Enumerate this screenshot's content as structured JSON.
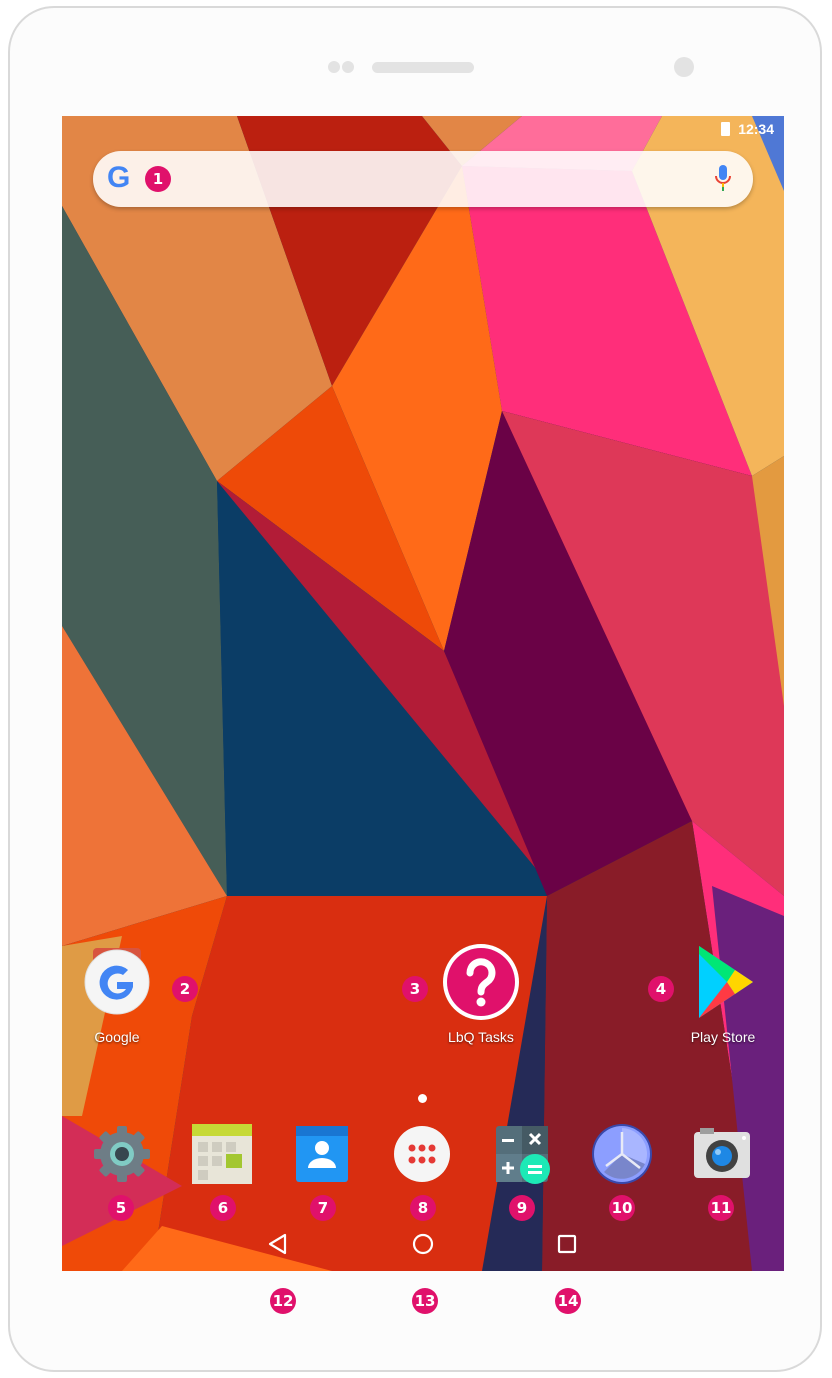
{
  "status_bar": {
    "time": "12:34"
  },
  "search_bar": {
    "logo": "G",
    "mic_icon": "mic-icon"
  },
  "home_apps": [
    {
      "label": "Google",
      "icon": "google-app-icon"
    },
    {
      "label": "LbQ Tasks",
      "icon": "lbq-tasks-icon"
    },
    {
      "label": "Play Store",
      "icon": "play-store-icon"
    }
  ],
  "dock": [
    {
      "icon": "settings-icon"
    },
    {
      "icon": "calendar-icon"
    },
    {
      "icon": "contacts-icon"
    },
    {
      "icon": "app-drawer-icon"
    },
    {
      "icon": "calculator-icon"
    },
    {
      "icon": "clock-icon"
    },
    {
      "icon": "camera-icon"
    }
  ],
  "nav_bar": [
    {
      "icon": "back-icon"
    },
    {
      "icon": "home-icon"
    },
    {
      "icon": "recents-icon"
    }
  ],
  "callouts": [
    "1",
    "2",
    "3",
    "4",
    "5",
    "6",
    "7",
    "8",
    "9",
    "10",
    "11",
    "12",
    "13",
    "14"
  ],
  "colors": {
    "callout": "#e0116b",
    "wallpaper_base": "#0b3d66"
  }
}
